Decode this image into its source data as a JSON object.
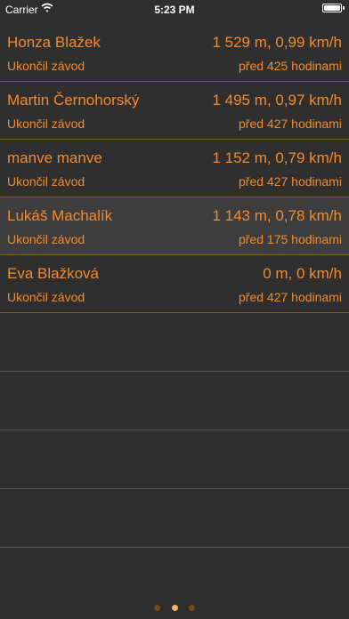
{
  "status_bar": {
    "carrier": "Carrier",
    "time": "5:23 PM",
    "wifi_icon": "wifi-icon",
    "battery_icon": "battery-icon"
  },
  "accent_color": "#f58a2b",
  "results": [
    {
      "name": "Honza Blažek",
      "stat": "1 529 m, 0,99 km/h",
      "status": "Ukončil závod",
      "ago": "před 425 hodinami"
    },
    {
      "name": "Martin Černohorský",
      "stat": "1 495 m, 0,97 km/h",
      "status": "Ukončil závod",
      "ago": "před 427 hodinami"
    },
    {
      "name": "manve manve",
      "stat": "1 152 m, 0,79 km/h",
      "status": "Ukončil závod",
      "ago": "před 427 hodinami"
    },
    {
      "name": "Lukáš Machalík",
      "stat": "1 143 m, 0,78 km/h",
      "status": "Ukončil závod",
      "ago": "před 175 hodinami"
    },
    {
      "name": "Eva Blažková",
      "stat": "0 m, 0 km/h",
      "status": "Ukončil závod",
      "ago": "před 427 hodinami"
    }
  ],
  "pager": {
    "pages": 3,
    "current": 2
  }
}
